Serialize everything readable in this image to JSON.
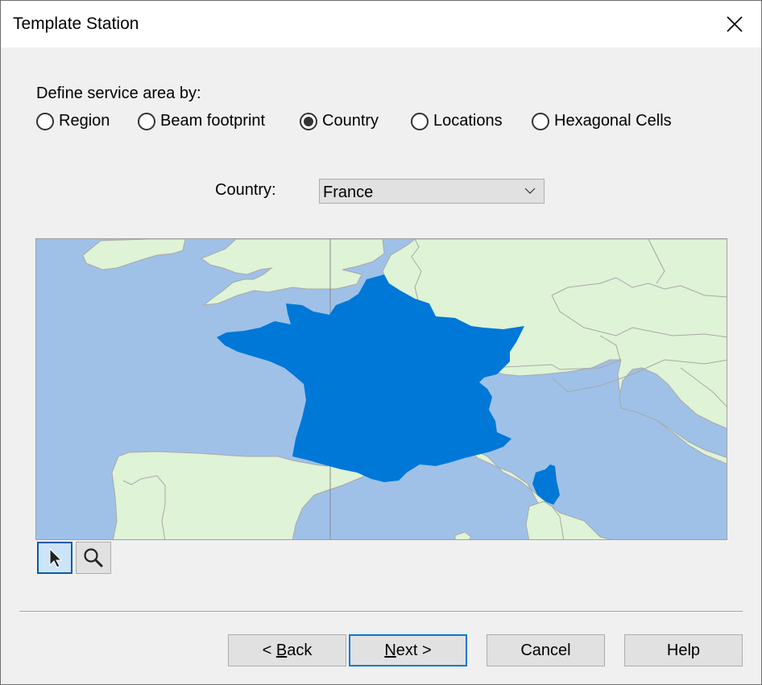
{
  "window": {
    "title": "Template Station",
    "close_icon": "close-icon"
  },
  "service_area": {
    "label": "Define service area by:",
    "options": [
      {
        "label": "Region",
        "selected": false
      },
      {
        "label": "Beam footprint",
        "selected": false
      },
      {
        "label": "Country",
        "selected": true
      },
      {
        "label": "Locations",
        "selected": false
      },
      {
        "label": "Hexagonal Cells",
        "selected": false
      }
    ]
  },
  "country": {
    "label": "Country:",
    "selected": "France",
    "dropdown_icon": "chevron-down-icon"
  },
  "map": {
    "highlighted_country": "France",
    "colors": {
      "sea": "#9fc1e8",
      "land": "#dff3d6",
      "border": "#a8a8a8",
      "highlight": "#0078d7"
    },
    "tools": [
      {
        "name": "pointer",
        "icon": "cursor-arrow-icon",
        "active": true
      },
      {
        "name": "zoom",
        "icon": "magnifier-icon",
        "active": false
      }
    ]
  },
  "footer": {
    "back": {
      "prefix": "< ",
      "mnemonic": "B",
      "rest": "ack"
    },
    "next": {
      "mnemonic": "N",
      "rest": "ext >"
    },
    "cancel": "Cancel",
    "help": "Help"
  }
}
